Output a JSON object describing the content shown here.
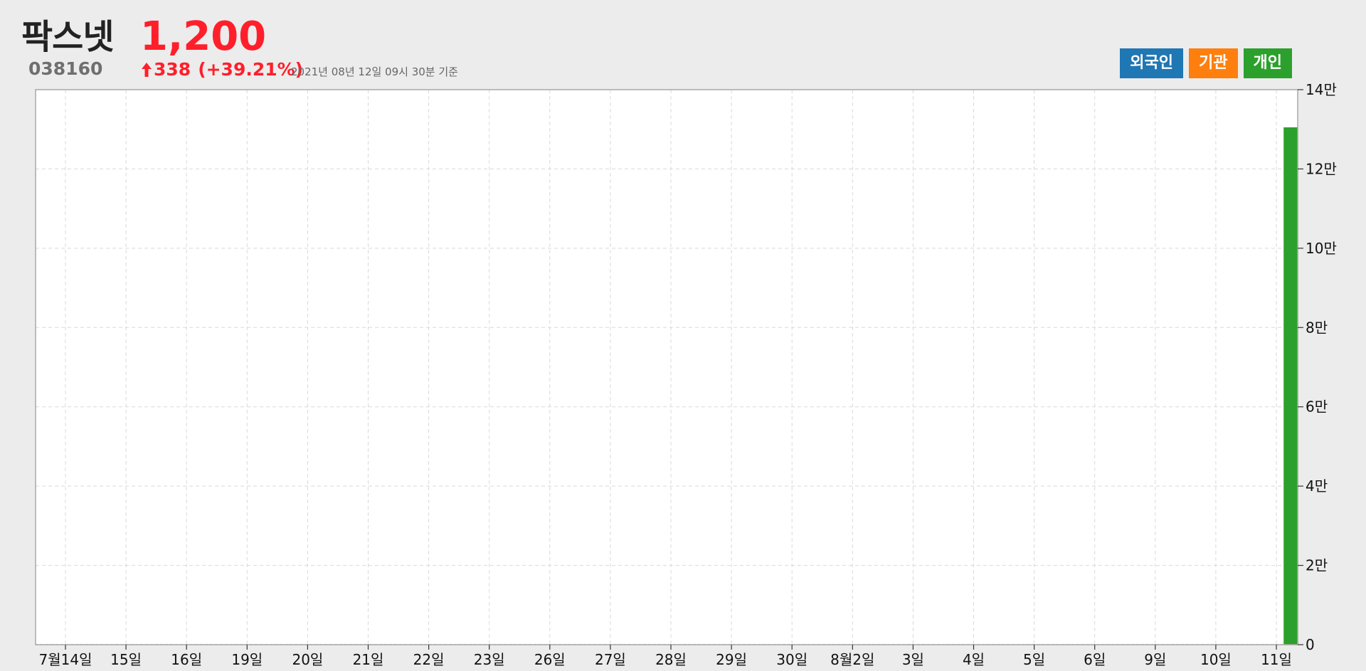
{
  "header": {
    "name": "팍스넷",
    "price": "1,200",
    "code": "038160",
    "change": "338",
    "change_pct": "(+39.21%)",
    "timestamp": "2021년 08년 12일 09시 30분 기준"
  },
  "legend": [
    {
      "label": "외국인",
      "color": "#1f77b4"
    },
    {
      "label": "기관",
      "color": "#ff7f0e"
    },
    {
      "label": "개인",
      "color": "#2ca02c"
    }
  ],
  "colors": {
    "price_up": "#ff1f2b",
    "grid": "#d9d9d9",
    "zero_line": "#e55a5a"
  },
  "chart_data": {
    "type": "bar",
    "categories": [
      "7월14일",
      "15일",
      "16일",
      "19일",
      "20일",
      "21일",
      "22일",
      "23일",
      "26일",
      "27일",
      "28일",
      "29일",
      "30일",
      "8월2일",
      "3일",
      "4일",
      "5일",
      "6일",
      "9일",
      "10일",
      "11일"
    ],
    "series": [
      {
        "name": "외국인",
        "color": "#1f77b4",
        "values": [
          0,
          0,
          0,
          0,
          0,
          0,
          0,
          0,
          0,
          0,
          0,
          0,
          0,
          0,
          0,
          0,
          0,
          0,
          0,
          0,
          0
        ]
      },
      {
        "name": "기관",
        "color": "#ff7f0e",
        "values": [
          0,
          0,
          0,
          0,
          0,
          0,
          0,
          0,
          0,
          0,
          0,
          0,
          0,
          0,
          0,
          0,
          0,
          0,
          0,
          0,
          0
        ]
      },
      {
        "name": "개인",
        "color": "#2ca02c",
        "values": [
          0,
          0,
          0,
          0,
          0,
          0,
          0,
          0,
          0,
          0,
          0,
          0,
          0,
          0,
          0,
          0,
          0,
          0,
          0,
          0,
          130500
        ]
      }
    ],
    "ylim": [
      0,
      140000
    ],
    "yticks": [
      0,
      20000,
      40000,
      60000,
      80000,
      100000,
      120000,
      140000
    ],
    "ytick_labels": [
      "0",
      "2만",
      "4만",
      "6만",
      "8만",
      "10만",
      "12만",
      "14만"
    ],
    "y_axis_position": "right",
    "grid": true
  }
}
